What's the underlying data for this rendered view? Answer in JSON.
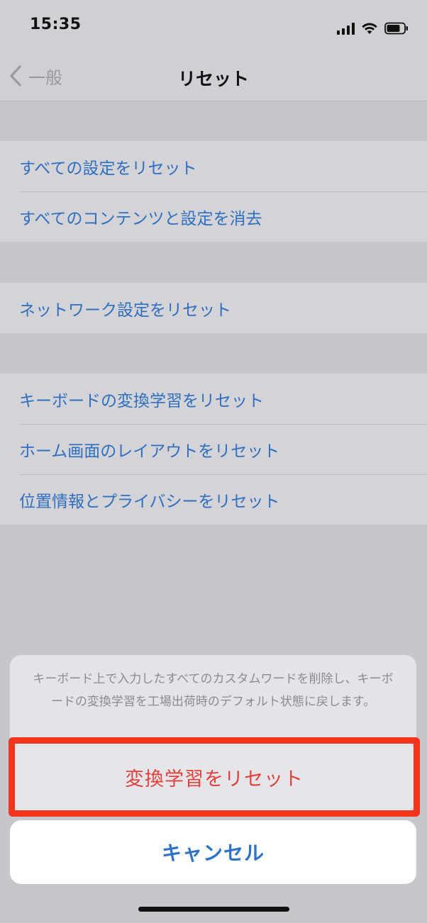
{
  "status_bar": {
    "time": "15:35",
    "icons": [
      "signal-icon",
      "wifi-icon",
      "battery-icon"
    ]
  },
  "nav": {
    "back_label": "一般",
    "title": "リセット"
  },
  "groups": [
    {
      "items": [
        "すべての設定をリセット",
        "すべてのコンテンツと設定を消去"
      ]
    },
    {
      "items": [
        "ネットワーク設定をリセット"
      ]
    },
    {
      "items": [
        "キーボードの変換学習をリセット",
        "ホーム画面のレイアウトをリセット",
        "位置情報とプライバシーをリセット"
      ]
    }
  ],
  "sheet": {
    "message": "キーボード上で入力したすべてのカスタムワードを削除し、キーボードの変換学習を工場出荷時のデフォルト状態に戻します。",
    "destructive_label": "変換学習をリセット",
    "cancel_label": "キャンセル"
  },
  "colors": {
    "link_blue": "#2f6fbf",
    "destructive_red": "#e0413a",
    "highlight_red": "#f2341c"
  }
}
